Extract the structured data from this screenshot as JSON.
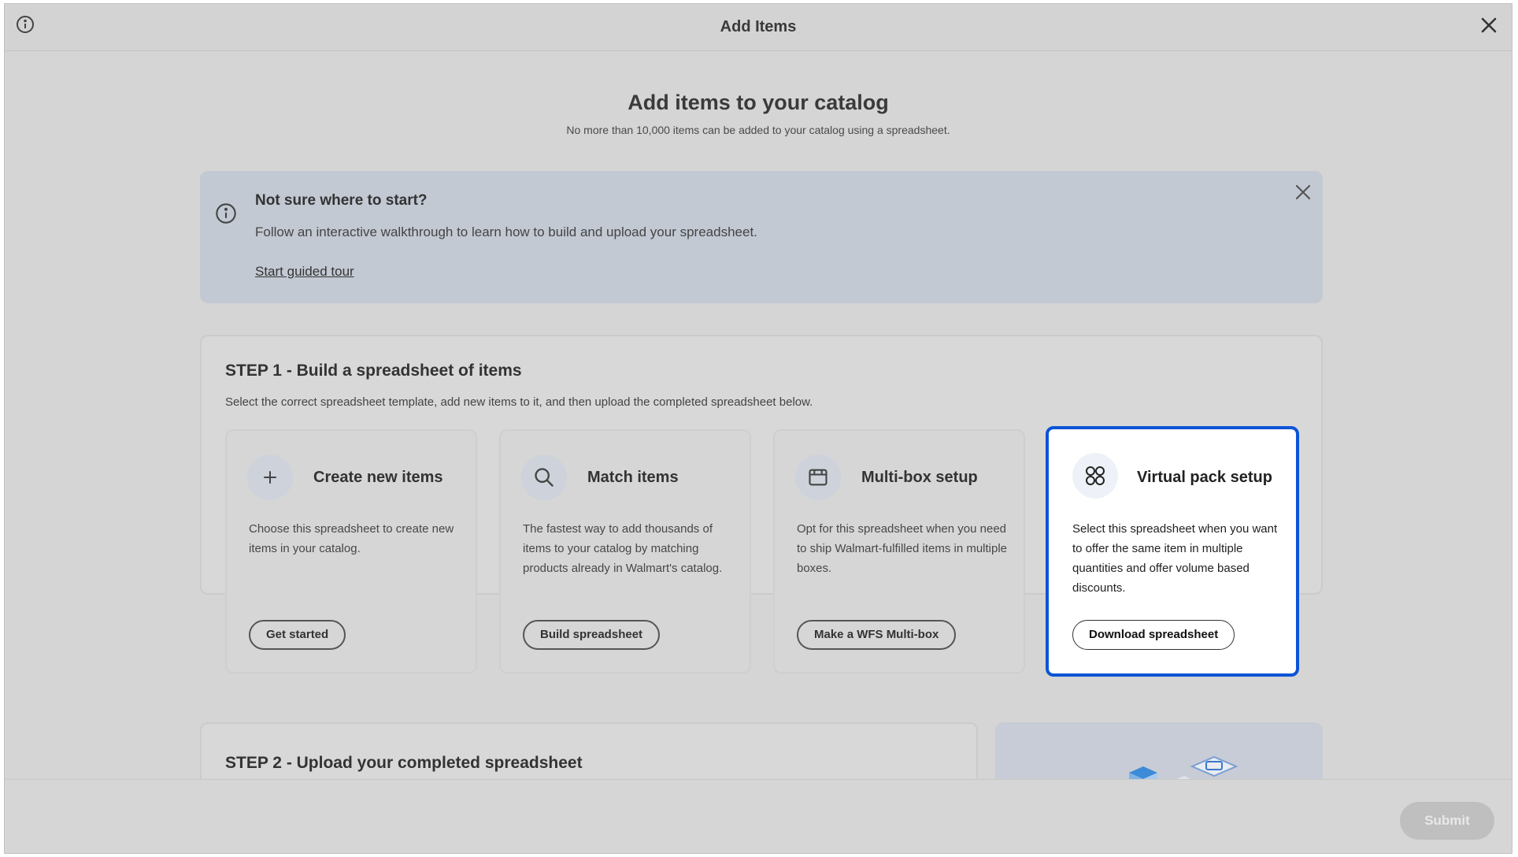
{
  "window": {
    "title": "Add Items"
  },
  "page": {
    "title": "Add items to your catalog",
    "subtitle": "No more than 10,000 items can be added to your catalog using a spreadsheet."
  },
  "banner": {
    "title": "Not sure where to start?",
    "text": "Follow an interactive walkthrough to learn how to build and upload your spreadsheet.",
    "link": "Start guided tour"
  },
  "step1": {
    "heading": "STEP 1 - Build a spreadsheet of items",
    "description": "Select the correct spreadsheet template, add new items to it, and then upload the completed spreadsheet below.",
    "cards": [
      {
        "icon": "plus-icon",
        "title": "Create new items",
        "description": "Choose this spreadsheet to create new items in your catalog.",
        "button": "Get started"
      },
      {
        "icon": "search-icon",
        "title": "Match items",
        "description": "The fastest way to add thousands of items to your catalog by matching products already in Walmart's catalog.",
        "button": "Build spreadsheet"
      },
      {
        "icon": "box-icon",
        "title": "Multi-box setup",
        "description": "Opt for this spreadsheet when you need to ship Walmart-fulfilled items in multiple boxes.",
        "button": "Make a WFS Multi-box"
      },
      {
        "icon": "virtual-pack-icon",
        "title": "Virtual pack setup",
        "description": "Select this spreadsheet when you want to offer the same item in multiple quantities and offer volume based discounts.",
        "button": "Download spreadsheet"
      }
    ]
  },
  "step2": {
    "heading": "STEP 2 - Upload your completed spreadsheet"
  },
  "footer": {
    "submit": "Submit"
  },
  "colors": {
    "accent": "#0b54d6",
    "overlay": "#d5d5d5",
    "banner": "#c3c9d3"
  }
}
